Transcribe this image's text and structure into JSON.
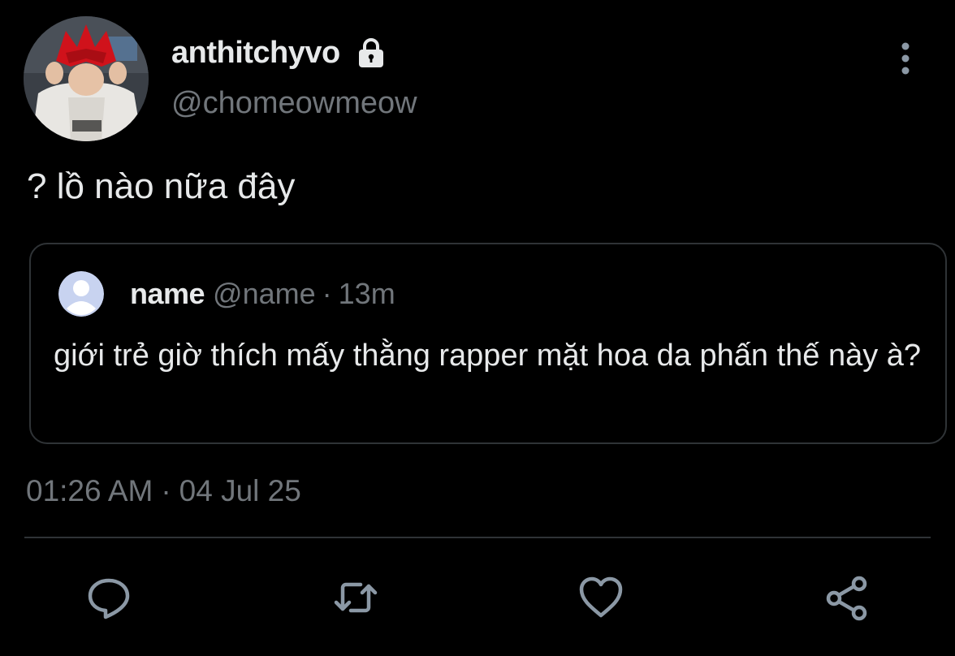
{
  "author": {
    "display_name": "anthitchyvo",
    "handle": "@chomeowmeow"
  },
  "icons": {
    "lock": "lock-icon",
    "more": "more-vertical-icon",
    "reply": "reply-icon",
    "retweet": "retweet-icon",
    "like": "heart-icon",
    "share": "share-icon"
  },
  "tweet": {
    "text": "? lồ nào nữa đây",
    "time": "01:26 AM",
    "separator": "·",
    "date": "04 Jul 25"
  },
  "quoted": {
    "name": "name",
    "handle": "@name",
    "separator": "·",
    "age": "13m",
    "text": "giới trẻ giờ thích mấy thằng rapper mặt hoa da phấn thế này à?"
  },
  "colors": {
    "background": "#000000",
    "text_primary": "#e7e9ea",
    "text_secondary": "#71767b",
    "border": "#2f3336",
    "icon": "#8b98a5"
  }
}
